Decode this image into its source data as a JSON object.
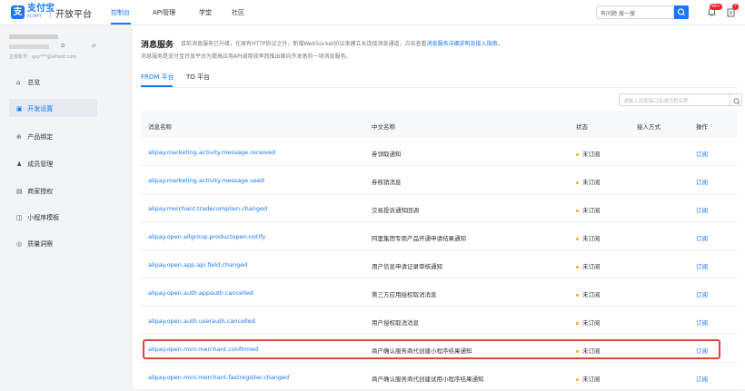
{
  "header": {
    "logo_mark": "支",
    "logo_text": "支付宝",
    "logo_sub": "ALIPAY",
    "platform": "开放平台",
    "nav": [
      "控制台",
      "API管理",
      "学堂",
      "社区"
    ],
    "search_placeholder": "有问题 搜一搜",
    "badge_messages": "99+",
    "badge_todo": "7"
  },
  "sidebar": {
    "account_id": "主体账号：qxy***@alitest.com",
    "items": [
      {
        "icon": "⌂",
        "label": "总览"
      },
      {
        "icon": "▣",
        "label": "开发设置"
      },
      {
        "icon": "⊕",
        "label": "产品绑定"
      },
      {
        "icon": "♟",
        "label": "成员管理"
      },
      {
        "icon": "▤",
        "label": "商家授权"
      },
      {
        "icon": "◫",
        "label": "小程序模板"
      },
      {
        "icon": "◎",
        "label": "质量洞察"
      }
    ]
  },
  "main": {
    "title": "消息服务",
    "desc1_prefix": "目前消息服务已升级，在原有HTTP协议之外，新增WebSocket协议来建立长连接消息通道，点击查看",
    "desc1_link": "消息服务详细说明及接入指南。",
    "desc2": "消息服务是支付宝开放平台为提高应用API调用效率而推出面向开发者的一项消息服务。",
    "tabs": [
      "FROM 平台",
      "TO 平台"
    ],
    "filter_placeholder": "请输入消息接口名或消息名称",
    "columns": [
      "消息名称",
      "中文名称",
      "状态",
      "接入方式",
      "操作"
    ],
    "rows": [
      {
        "name": "alipay.marketing.activity.message.received",
        "cn": "券领取通知",
        "status": "未订阅",
        "op": "订阅"
      },
      {
        "name": "alipay.marketing.activity.message.used",
        "cn": "券核销消息",
        "status": "未订阅",
        "op": "订阅"
      },
      {
        "name": "alipay.merchant.tradecomplain.changed",
        "cn": "交易投诉通知回调",
        "status": "未订阅",
        "op": "订阅"
      },
      {
        "name": "alipay.open.allgroup.productopen.notify",
        "cn": "阿里集团专用产品开通申请结果通知",
        "status": "未订阅",
        "op": "订阅"
      },
      {
        "name": "alipay.open.app.api.field.changed",
        "cn": "用户信息申请记录审核通知",
        "status": "未订阅",
        "op": "订阅"
      },
      {
        "name": "alipay.open.auth.appauth.cancelled",
        "cn": "第三方应用授权取消消息",
        "status": "未订阅",
        "op": "订阅"
      },
      {
        "name": "alipay.open.auth.userauth.cancelled",
        "cn": "用户授权取消消息",
        "status": "未订阅",
        "op": "订阅"
      },
      {
        "name": "alipay.open.mini.merchant.confirmed",
        "cn": "商户确认服务商代创建小程序结果通知",
        "status": "未订阅",
        "op": "订阅"
      },
      {
        "name": "alipay.open.mini.merchant.fastregister.changed",
        "cn": "商户确认服务商代创建试用小程序结果通知",
        "status": "未订阅",
        "op": "订阅"
      }
    ]
  }
}
